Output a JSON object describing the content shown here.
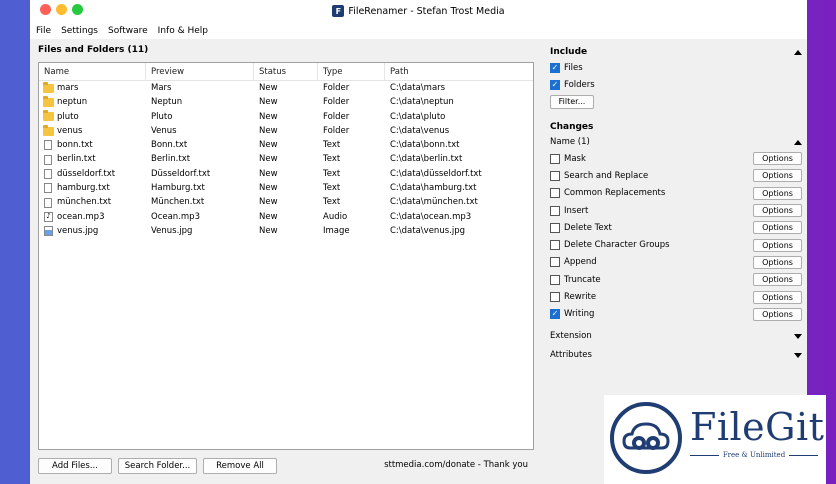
{
  "window": {
    "title": "FileRenamer - Stefan Trost Media",
    "app_icon": "F"
  },
  "menu": [
    "File",
    "Settings",
    "Software",
    "Info & Help"
  ],
  "files": {
    "title": "Files and Folders (11)",
    "columns": [
      "Name",
      "Preview",
      "Status",
      "Type",
      "Path"
    ],
    "rows": [
      {
        "icon": "folder-icon",
        "name": "mars",
        "preview": "Mars",
        "status": "New",
        "type": "Folder",
        "path": "C:\\data\\mars"
      },
      {
        "icon": "folder-icon",
        "name": "neptun",
        "preview": "Neptun",
        "status": "New",
        "type": "Folder",
        "path": "C:\\data\\neptun"
      },
      {
        "icon": "folder-icon",
        "name": "pluto",
        "preview": "Pluto",
        "status": "New",
        "type": "Folder",
        "path": "C:\\data\\pluto"
      },
      {
        "icon": "folder-icon",
        "name": "venus",
        "preview": "Venus",
        "status": "New",
        "type": "Folder",
        "path": "C:\\data\\venus"
      },
      {
        "icon": "text-file-icon",
        "name": "bonn.txt",
        "preview": "Bonn.txt",
        "status": "New",
        "type": "Text",
        "path": "C:\\data\\bonn.txt"
      },
      {
        "icon": "text-file-icon",
        "name": "berlin.txt",
        "preview": "Berlin.txt",
        "status": "New",
        "type": "Text",
        "path": "C:\\data\\berlin.txt"
      },
      {
        "icon": "text-file-icon",
        "name": "düsseldorf.txt",
        "preview": "Düsseldorf.txt",
        "status": "New",
        "type": "Text",
        "path": "C:\\data\\düsseldorf.txt"
      },
      {
        "icon": "text-file-icon",
        "name": "hamburg.txt",
        "preview": "Hamburg.txt",
        "status": "New",
        "type": "Text",
        "path": "C:\\data\\hamburg.txt"
      },
      {
        "icon": "text-file-icon",
        "name": "münchen.txt",
        "preview": "München.txt",
        "status": "New",
        "type": "Text",
        "path": "C:\\data\\münchen.txt"
      },
      {
        "icon": "audio-file-icon",
        "name": "ocean.mp3",
        "preview": "Ocean.mp3",
        "status": "New",
        "type": "Audio",
        "path": "C:\\data\\ocean.mp3"
      },
      {
        "icon": "image-file-icon",
        "name": "venus.jpg",
        "preview": "Venus.jpg",
        "status": "New",
        "type": "Image",
        "path": "C:\\data\\venus.jpg"
      }
    ],
    "buttons": {
      "add": "Add Files...",
      "search": "Search Folder...",
      "remove": "Remove All"
    },
    "donate": "sttmedia.com/donate - Thank you"
  },
  "include": {
    "title": "Include",
    "files_label": "Files",
    "files_checked": true,
    "folders_label": "Folders",
    "folders_checked": true,
    "filter_button": "Filter..."
  },
  "changes": {
    "title": "Changes",
    "name_section": "Name (1)",
    "options_label": "Options",
    "items": [
      {
        "label": "Mask",
        "checked": false
      },
      {
        "label": "Search and Replace",
        "checked": false
      },
      {
        "label": "Common Replacements",
        "checked": false
      },
      {
        "label": "Insert",
        "checked": false
      },
      {
        "label": "Delete Text",
        "checked": false
      },
      {
        "label": "Delete Character Groups",
        "checked": false
      },
      {
        "label": "Append",
        "checked": false
      },
      {
        "label": "Truncate",
        "checked": false
      },
      {
        "label": "Rewrite",
        "checked": false
      },
      {
        "label": "Writing",
        "checked": true
      }
    ],
    "extension": "Extension",
    "attributes": "Attributes"
  },
  "watermark": {
    "brand": "FileGit",
    "tagline": "Free & Unlimited"
  },
  "colors": {
    "accent": "#1a6fd1",
    "brand": "#1f3d73",
    "folder": "#f5c542"
  }
}
